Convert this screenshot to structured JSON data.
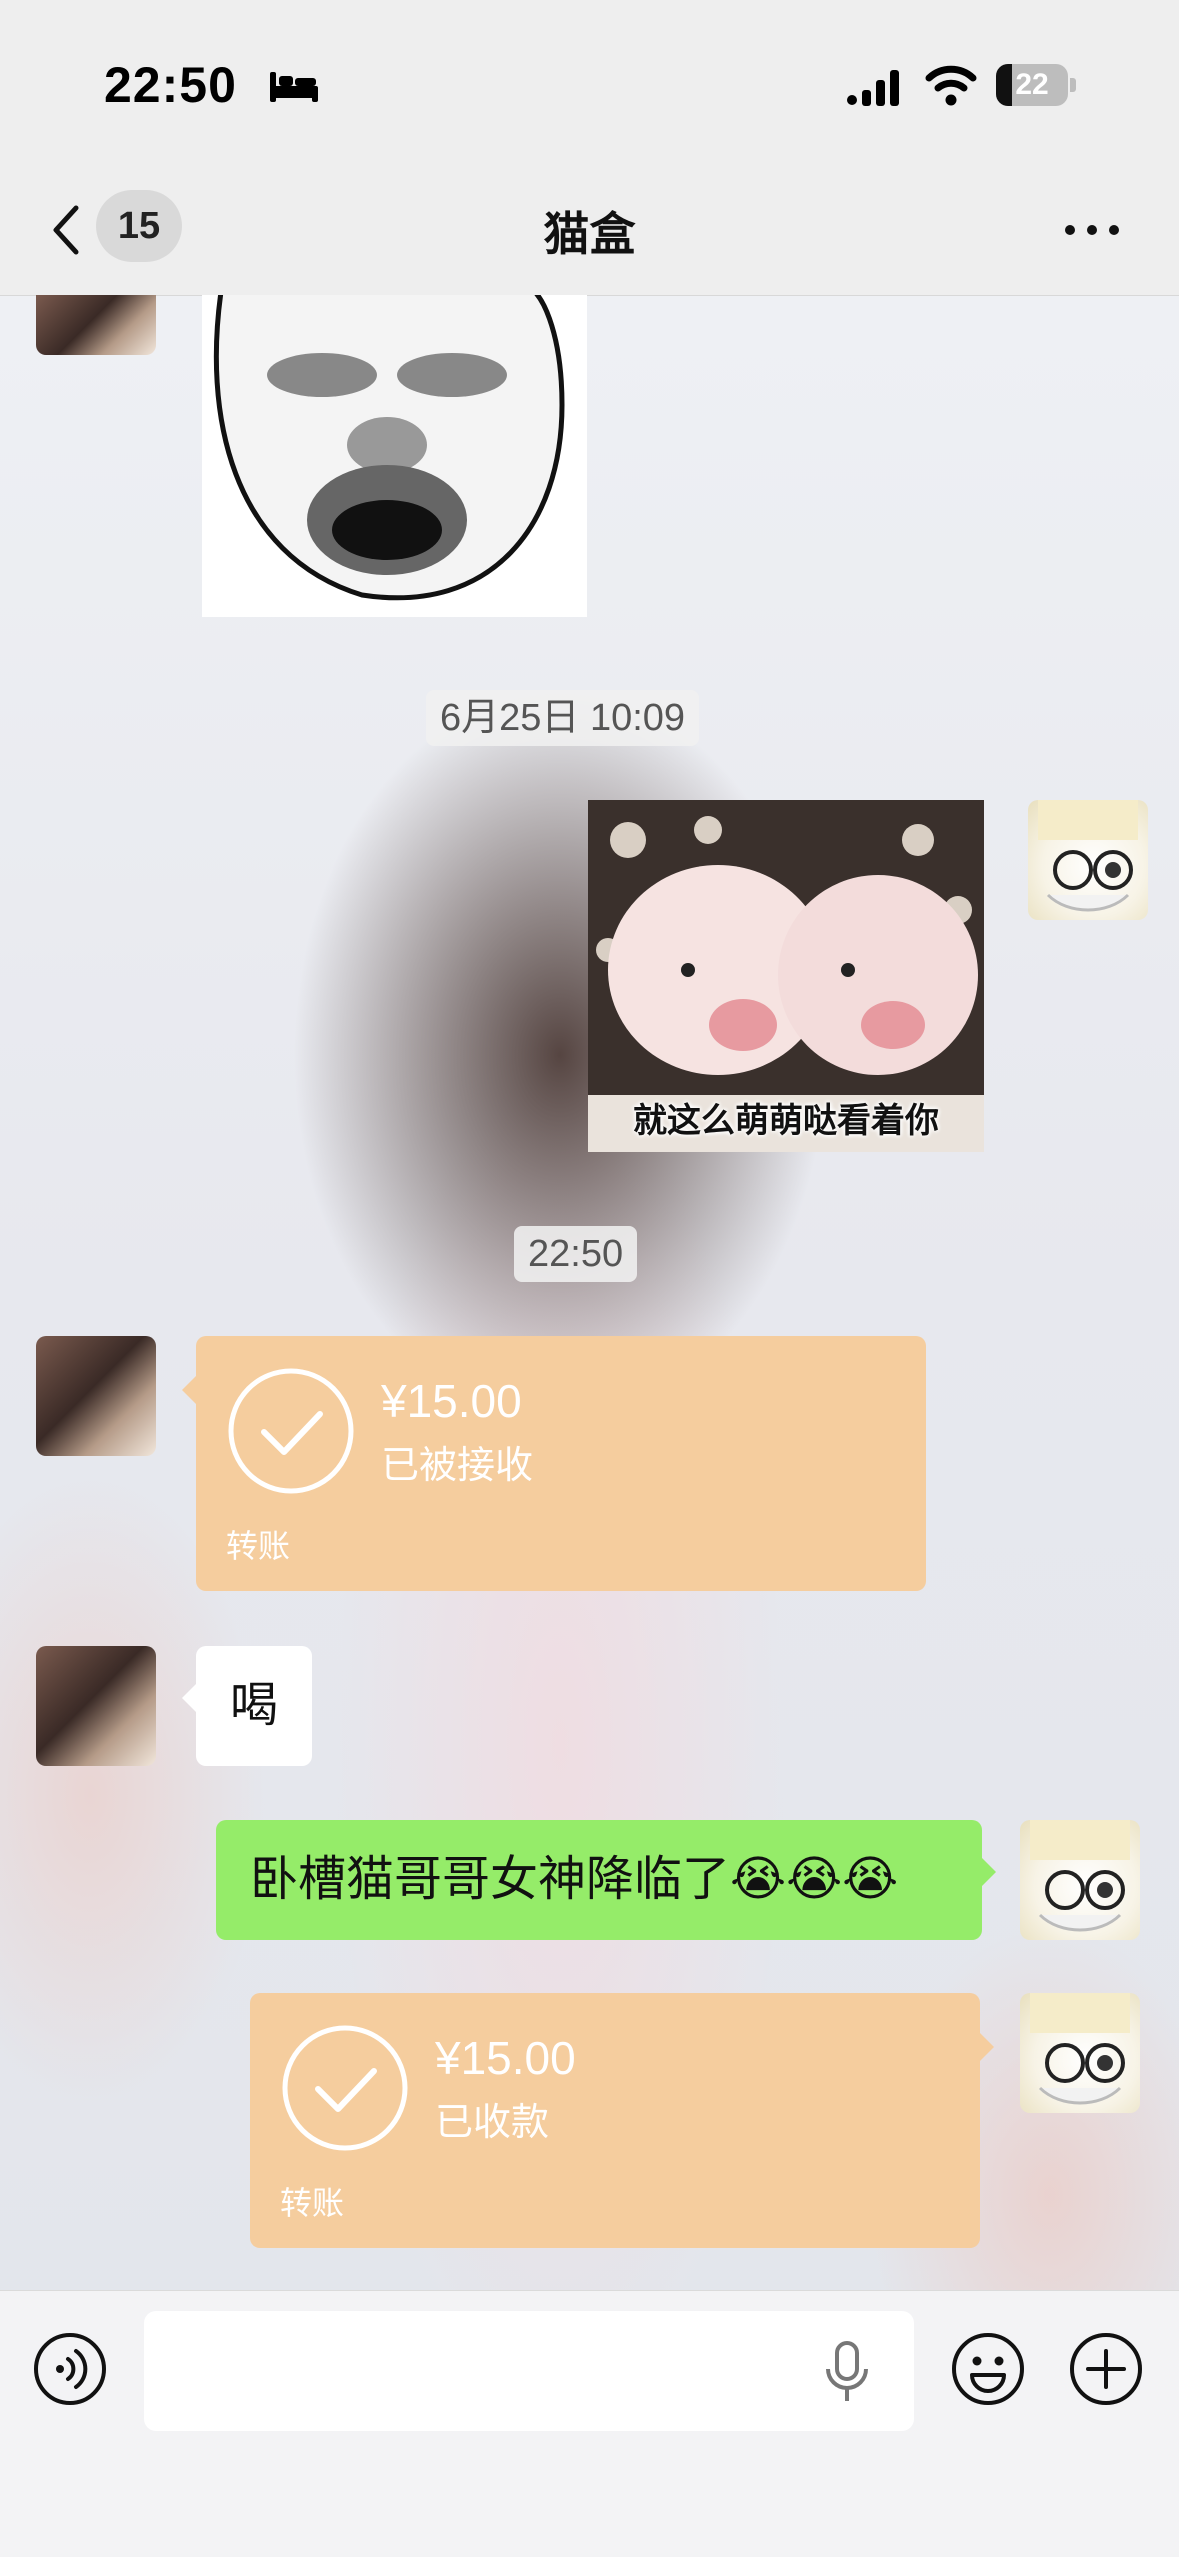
{
  "status_bar": {
    "time": "22:50",
    "focus_icon": "bed-icon",
    "signal_icon": "cellular-signal-icon",
    "wifi_icon": "wifi-icon",
    "battery_level": "22"
  },
  "nav": {
    "back_icon": "chevron-left-icon",
    "unread_count": "15",
    "title": "猫盒",
    "more_icon": "more-dots-icon"
  },
  "messages": {
    "timestamp_1": "6月25日 10:09",
    "pig_sticker_caption": "就这么萌萌哒看着你",
    "timestamp_2": "22:50",
    "transfer_1": {
      "amount": "¥15.00",
      "status": "已被接收",
      "label": "转账"
    },
    "incoming_text": "喝",
    "outgoing_text": "卧槽猫哥哥女神降临了😭😭😭",
    "transfer_2": {
      "amount": "¥15.00",
      "status": "已收款",
      "label": "转账"
    }
  },
  "input_bar": {
    "voice_icon": "voice-input-icon",
    "mic_icon": "microphone-icon",
    "emoji_icon": "emoji-icon",
    "plus_icon": "plus-icon",
    "text_value": ""
  },
  "colors": {
    "transfer_bg": "#f5cd9e",
    "outgoing_bubble": "#95ec69",
    "incoming_bubble": "#ffffff"
  }
}
